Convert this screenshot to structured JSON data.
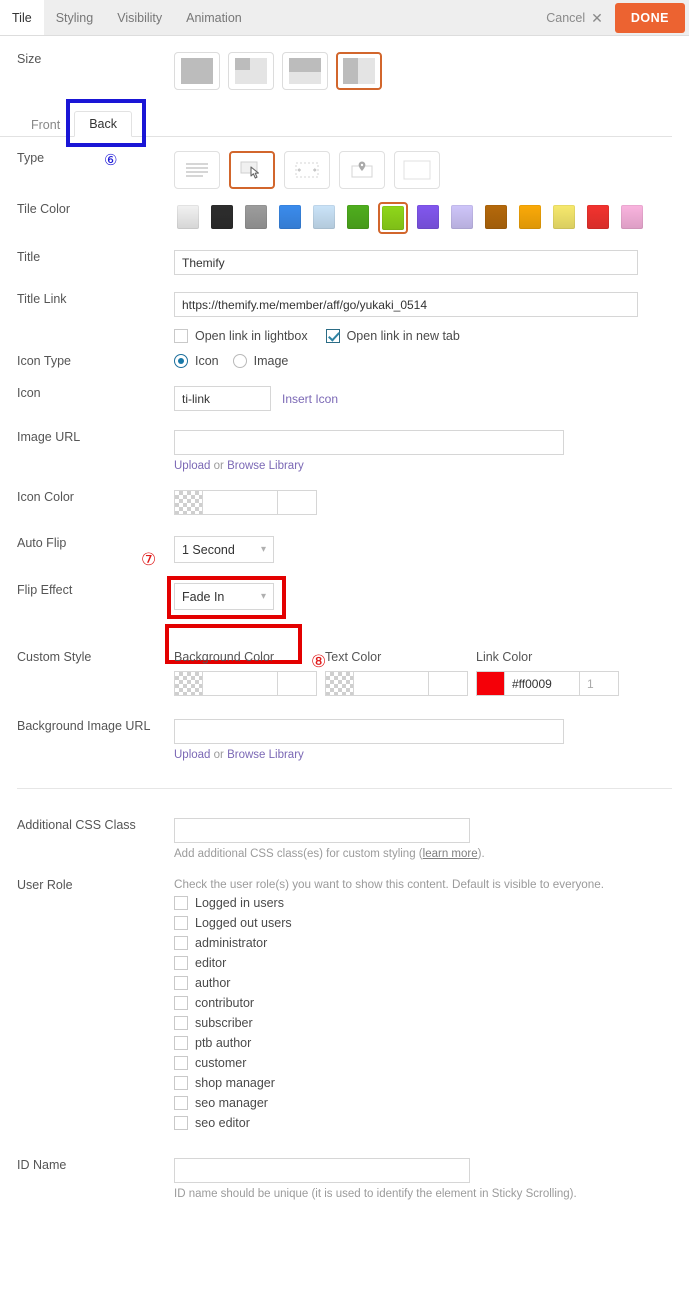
{
  "header": {
    "tabs": [
      {
        "label": "Tile",
        "active": true
      },
      {
        "label": "Styling",
        "active": false
      },
      {
        "label": "Visibility",
        "active": false
      },
      {
        "label": "Animation",
        "active": false
      }
    ],
    "cancel_label": "Cancel",
    "cancel_icon": "close-x-icon",
    "done_label": "DONE",
    "done_color": "#ec6331"
  },
  "size": {
    "label": "Size",
    "options": [
      "full-block",
      "quarter-block",
      "half-horizontal",
      "half-vertical"
    ],
    "selected_index": 3,
    "selected_outline_color": "#d2662c"
  },
  "face_tabs": {
    "front_label": "Front",
    "back_label": "Back",
    "active": "Back"
  },
  "type": {
    "label": "Type",
    "options": [
      "text-lines-icon",
      "button-click-icon",
      "slider-icon",
      "map-pin-icon",
      "blank-icon"
    ],
    "selected_index": 1
  },
  "tile_color": {
    "label": "Tile Color",
    "swatches": [
      "#f2f2f2",
      "#2e2e2e",
      "#9d9d9d",
      "#3b8ced",
      "#cbe4f9",
      "#4fae1e",
      "#8fd71a",
      "#8257ef",
      "#cfc6fa",
      "#b5690b",
      "#fbaa08",
      "#f7e96d",
      "#f3332f",
      "#fab4df"
    ],
    "selected_index": 6,
    "selected_outline_color": "#d2662c"
  },
  "title": {
    "label": "Title",
    "value": "Themify"
  },
  "title_link": {
    "label": "Title Link",
    "value": "https://themify.me/member/aff/go/yukaki_0514"
  },
  "link_options": {
    "lightbox_label": "Open link in lightbox",
    "lightbox_checked": false,
    "newtab_label": "Open link in new tab",
    "newtab_checked": true
  },
  "icon_type": {
    "label": "Icon Type",
    "options": [
      "Icon",
      "Image"
    ],
    "selected": "Icon"
  },
  "icon": {
    "label": "Icon",
    "value": "ti-link",
    "insert_label": "Insert Icon"
  },
  "image_url": {
    "label": "Image URL",
    "value": "",
    "upload_label": "Upload",
    "or_label": " or ",
    "browse_label": "Browse Library"
  },
  "icon_color": {
    "label": "Icon Color",
    "value": "",
    "opacity": "",
    "transparent": true
  },
  "auto_flip": {
    "label": "Auto Flip",
    "value": "1 Second"
  },
  "flip_effect": {
    "label": "Flip Effect",
    "value": "Fade In"
  },
  "custom_style": {
    "label": "Custom Style",
    "background_color": {
      "label": "Background Color",
      "value": "",
      "opacity": "",
      "transparent": true
    },
    "text_color": {
      "label": "Text Color",
      "value": "",
      "opacity": "",
      "transparent": true
    },
    "link_color": {
      "label": "Link Color",
      "value": "#ff0009",
      "opacity": "1",
      "swatch": "#f50008",
      "transparent": false
    }
  },
  "background_image_url": {
    "label": "Background Image URL",
    "value": "",
    "upload_label": "Upload",
    "or_label": " or ",
    "browse_label": "Browse Library"
  },
  "additional_css": {
    "label": "Additional CSS Class",
    "value": "",
    "helper_prefix": "Add additional CSS class(es) for custom styling (",
    "helper_link": "learn more",
    "helper_suffix": ")."
  },
  "user_role": {
    "label": "User Role",
    "helper": "Check the user role(s) you want to show this content. Default is visible to everyone.",
    "roles": [
      "Logged in users",
      "Logged out users",
      "administrator",
      "editor",
      "author",
      "contributor",
      "subscriber",
      "ptb author",
      "customer",
      "shop manager",
      "seo manager",
      "seo editor"
    ]
  },
  "id_name": {
    "label": "ID Name",
    "value": "",
    "helper": "ID name should be unique (it is used to identify the element in Sticky Scrolling)."
  },
  "annotations": [
    {
      "id": "6",
      "marker": "⑥",
      "color": "#1a16d6",
      "shape": "rect",
      "target": "back-tab"
    },
    {
      "id": "7",
      "marker": "⑦",
      "color": "#e01b1b",
      "shape": "rect",
      "target": "auto-flip-select"
    },
    {
      "id": "8",
      "marker": "⑧",
      "color": "#e01b1b",
      "shape": "rect",
      "target": "flip-effect-select"
    }
  ]
}
